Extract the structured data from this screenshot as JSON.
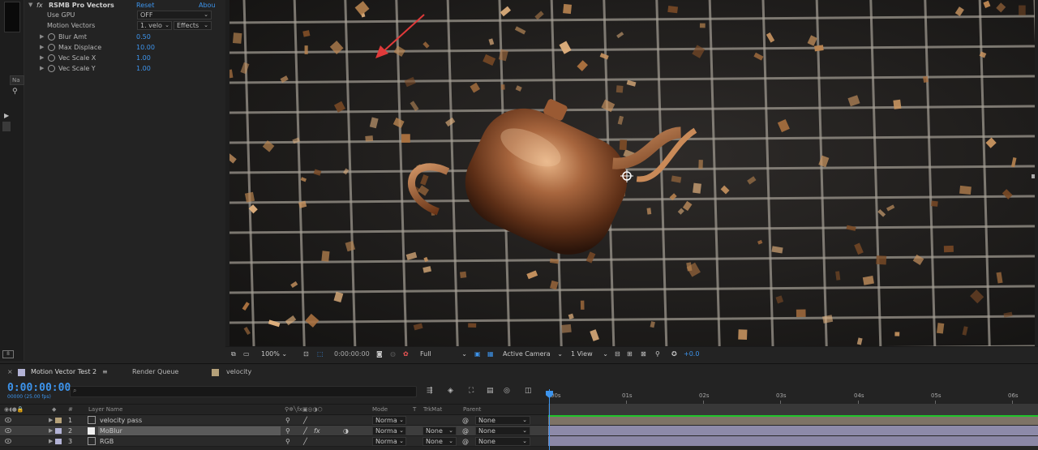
{
  "effects": {
    "effect_name": "RSMB Pro Vectors",
    "fx_label": "fx",
    "reset_label": "Reset",
    "about_label": "Abou",
    "params": [
      {
        "name": "Use GPU",
        "value": "OFF",
        "kind": "dropdown"
      },
      {
        "name": "Motion Vectors",
        "value": "1. velo",
        "kind": "dropdown2",
        "value2": "Effects"
      },
      {
        "name": "Blur Amt",
        "value": "0.50",
        "kind": "number"
      },
      {
        "name": "Max Displace",
        "value": "10.00",
        "kind": "number"
      },
      {
        "name": "Vec Scale X",
        "value": "1.00",
        "kind": "number"
      },
      {
        "name": "Vec Scale Y",
        "value": "1.00",
        "kind": "number"
      }
    ]
  },
  "left_panel": {
    "tab_label": "Na"
  },
  "viewer": {
    "zoom": "100%",
    "timecode": "0:00:00:00",
    "resolution": "Full",
    "camera": "Active Camera",
    "views": "1 View",
    "exposure": "+0.0",
    "annotation_color": "#e03a3a",
    "accent": "#3d94ec"
  },
  "timeline": {
    "tabs": [
      {
        "label": "Motion Vector Test 2"
      },
      {
        "label": "Render Queue"
      },
      {
        "label": "velocity"
      }
    ],
    "timecode": "0:00:00:00",
    "timecode_sub": "00000 (25.00 fps)",
    "search_placeholder": "",
    "columns": {
      "num": "#",
      "layer_name": "Layer Name",
      "mode": "Mode",
      "t": "T",
      "trkmat": "TrkMat",
      "parent": "Parent"
    },
    "ruler": [
      "00s",
      "01s",
      "02s",
      "03s",
      "04s",
      "05s",
      "06s"
    ],
    "layers": [
      {
        "num": "1",
        "name": "velocity pass",
        "mode": "Norma",
        "trkmat": "",
        "parent": "None",
        "label_color": "#b5a179",
        "bar_color": "#7e7366"
      },
      {
        "num": "2",
        "name": "MoBlur",
        "mode": "Norma",
        "trkmat": "None",
        "parent": "None",
        "label_color": "#b3b3d6",
        "bar_color": "#8d8aa9"
      },
      {
        "num": "3",
        "name": "RGB",
        "mode": "Norma",
        "trkmat": "None",
        "parent": "None",
        "label_color": "#b3b3d6",
        "bar_color": "#8b87a6"
      }
    ]
  }
}
